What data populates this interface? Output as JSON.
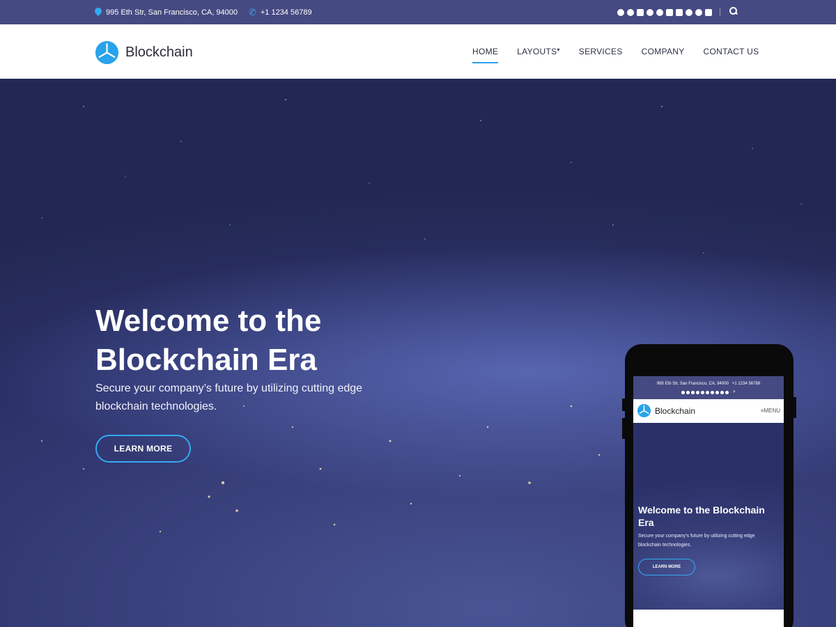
{
  "topbar": {
    "address": "995 Eth Str, San Francisco, CA, 94000",
    "phone": "+1 1234 56789",
    "social_icons": [
      "facebook-icon",
      "twitter-icon",
      "instagram-icon",
      "snapchat-icon",
      "pinterest-icon",
      "youtube-icon",
      "linkedin-icon",
      "wordpress-icon",
      "telegram-icon",
      "rss-icon"
    ],
    "search_icon": "search-icon"
  },
  "header": {
    "brand": "Blockchain",
    "nav": {
      "home": "HOME",
      "layouts": "LAYOUTS",
      "services": "SERVICES",
      "company": "COMPANY",
      "contact": "CONTACT US"
    }
  },
  "hero": {
    "title": "Welcome to the Blockchain Era",
    "subtitle": "Secure your company’s future by utilizing cutting edge blockchain technologies.",
    "cta": "LEARN MORE"
  },
  "mobile": {
    "address": "995 Eth Str, San Francisco, CA, 94000",
    "phone": "+1 1234 56789",
    "brand": "Blockchain",
    "menu": "MENU",
    "title": "Welcome to the Blockchain Era",
    "subtitle": "Secure your company’s future by utilizing cutting edge blockchain technologies.",
    "cta": "LEARN MORE"
  },
  "colors": {
    "topbar": "#464a82",
    "accent": "#29a3ea",
    "hero_base": "#2d336b"
  }
}
